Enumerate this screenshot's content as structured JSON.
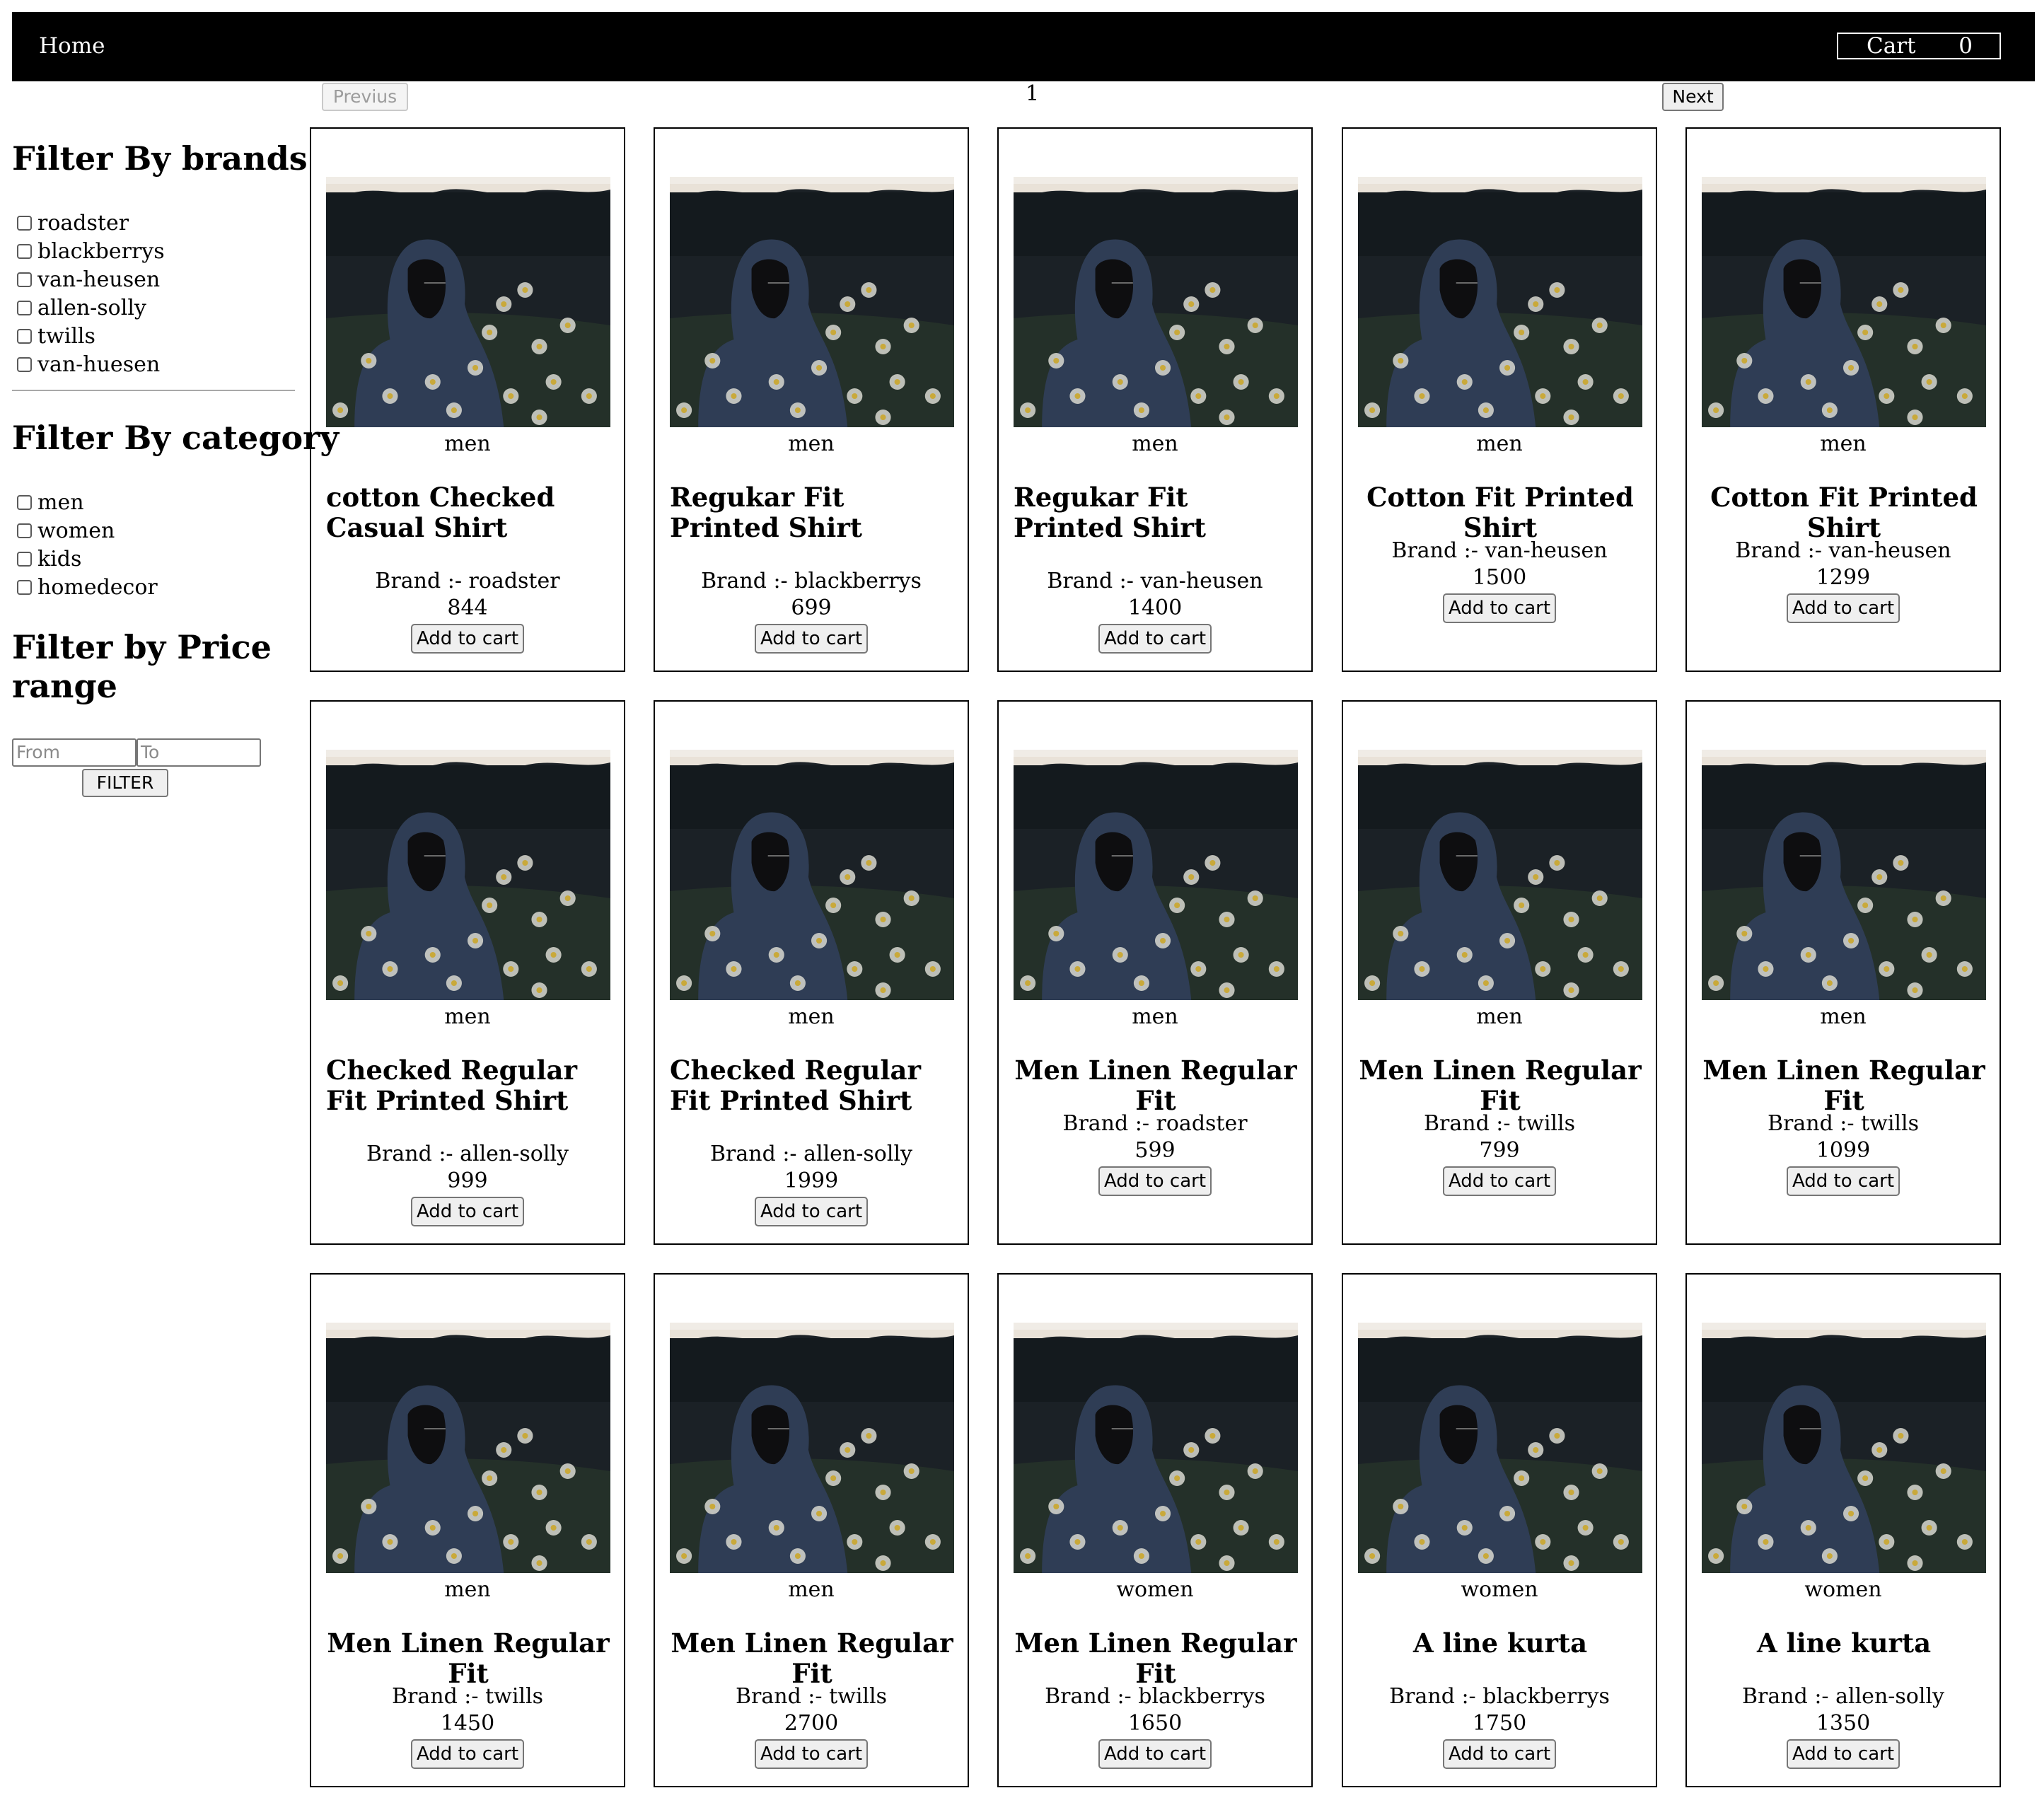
{
  "nav": {
    "home_label": "Home",
    "cart_label": "Cart",
    "cart_count": "0"
  },
  "pagination": {
    "prev_label": "Previus",
    "page": "1",
    "next_label": "Next"
  },
  "filters": {
    "brands_heading": "Filter By brands",
    "brands": [
      "roadster",
      "blackberrys",
      "van-heusen",
      "allen-solly",
      "twills",
      "van-huesen"
    ],
    "category_heading": "Filter By category",
    "categories": [
      "men",
      "women",
      "kids",
      "homedecor"
    ],
    "price_heading": "Filter by Price range",
    "from_placeholder": "From",
    "to_placeholder": "To",
    "filter_button": "FILTER"
  },
  "add_to_cart_label": "Add to cart",
  "brand_prefix": "Brand :- ",
  "products": [
    {
      "category": "men",
      "name": "cotton Checked Casual Shirt",
      "brand": "roadster",
      "price": "844"
    },
    {
      "category": "men",
      "name": "Regukar Fit Printed Shirt",
      "brand": "blackberrys",
      "price": "699"
    },
    {
      "category": "men",
      "name": "Regukar Fit Printed Shirt",
      "brand": "van-heusen",
      "price": "1400"
    },
    {
      "category": "men",
      "name": "Cotton Fit Printed Shirt",
      "brand": "van-heusen",
      "price": "1500"
    },
    {
      "category": "men",
      "name": "Cotton Fit Printed Shirt",
      "brand": "van-heusen",
      "price": "1299"
    },
    {
      "category": "men",
      "name": "Checked Regular Fit Printed Shirt",
      "brand": "allen-solly",
      "price": "999"
    },
    {
      "category": "men",
      "name": "Checked Regular Fit Printed Shirt",
      "brand": "allen-solly",
      "price": "1999"
    },
    {
      "category": "men",
      "name": "Men Linen Regular Fit",
      "brand": "roadster",
      "price": "599"
    },
    {
      "category": "men",
      "name": "Men Linen Regular Fit",
      "brand": "twills",
      "price": "799"
    },
    {
      "category": "men",
      "name": "Men Linen Regular Fit",
      "brand": "twills",
      "price": "1099"
    },
    {
      "category": "men",
      "name": "Men Linen Regular Fit",
      "brand": "twills",
      "price": "1450"
    },
    {
      "category": "men",
      "name": "Men Linen Regular Fit",
      "brand": "twills",
      "price": "2700"
    },
    {
      "category": "women",
      "name": "Men Linen Regular Fit",
      "brand": "blackberrys",
      "price": "1650"
    },
    {
      "category": "women",
      "name": "A line kurta",
      "brand": "blackberrys",
      "price": "1750"
    },
    {
      "category": "women",
      "name": "A line kurta",
      "brand": "allen-solly",
      "price": "1350"
    }
  ]
}
